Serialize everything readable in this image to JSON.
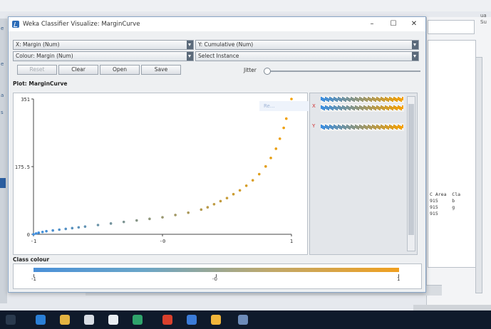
{
  "window": {
    "title": "Weka Classifier Visualize: MarginCurve"
  },
  "controls": {
    "x_axis": "X: Margin (Num)",
    "y_axis": "Y: Cumulative (Num)",
    "colour": "Colour: Margin (Num)",
    "instance": "Select Instance",
    "reset": "Reset",
    "clear": "Clear",
    "open": "Open",
    "save": "Save",
    "jitter": "Jitter"
  },
  "plot": {
    "label": "Plot: MarginCurve",
    "tooltip": "Re..."
  },
  "side_panel": {
    "x_label": "X",
    "y_label": "Y"
  },
  "legend": {
    "label": "Class colour",
    "min": "-1",
    "mid": "-0",
    "max": "1"
  },
  "background": {
    "right_label": "ua\nSu",
    "result_text": "C Area  Cla\n915     b\n915     g\n915"
  },
  "chart_data": {
    "type": "scatter",
    "title": "",
    "xlabel": "",
    "ylabel": "",
    "x_ticks": [
      "-1",
      "-0",
      "1"
    ],
    "y_ticks": [
      "0",
      "175.5",
      "351"
    ],
    "xlim": [
      -1,
      1
    ],
    "ylim": [
      0,
      351
    ],
    "color_scale": {
      "min_color": "#3c8ee0",
      "max_color": "#f5a000"
    },
    "series": [
      {
        "points": [
          [
            -1.0,
            0
          ],
          [
            -0.98,
            2
          ],
          [
            -0.96,
            4
          ],
          [
            -0.93,
            6
          ],
          [
            -0.9,
            8
          ],
          [
            -0.85,
            10
          ],
          [
            -0.8,
            12
          ],
          [
            -0.75,
            14
          ],
          [
            -0.7,
            16
          ],
          [
            -0.65,
            18
          ],
          [
            -0.6,
            20
          ],
          [
            -0.5,
            24
          ],
          [
            -0.4,
            28
          ],
          [
            -0.3,
            32
          ],
          [
            -0.2,
            36
          ],
          [
            -0.1,
            40
          ],
          [
            0.0,
            44
          ],
          [
            0.1,
            50
          ],
          [
            0.2,
            56
          ],
          [
            0.3,
            64
          ],
          [
            0.35,
            70
          ],
          [
            0.4,
            78
          ],
          [
            0.45,
            86
          ],
          [
            0.5,
            94
          ],
          [
            0.55,
            104
          ],
          [
            0.6,
            114
          ],
          [
            0.65,
            126
          ],
          [
            0.7,
            140
          ],
          [
            0.75,
            156
          ],
          [
            0.8,
            176
          ],
          [
            0.84,
            198
          ],
          [
            0.88,
            222
          ],
          [
            0.91,
            248
          ],
          [
            0.94,
            276
          ],
          [
            0.96,
            300
          ],
          [
            0.98,
            326
          ],
          [
            1.0,
            351
          ]
        ]
      }
    ]
  }
}
